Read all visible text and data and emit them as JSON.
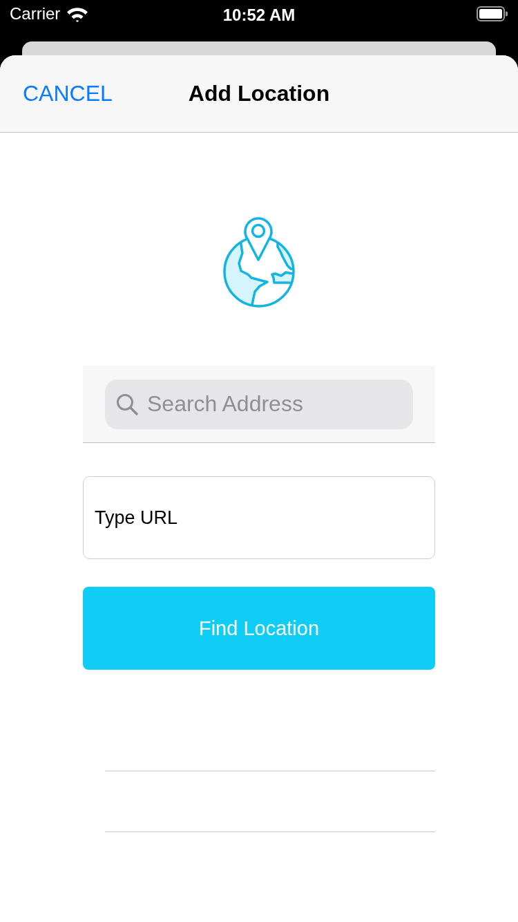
{
  "status_bar": {
    "carrier": "Carrier",
    "time": "10:52 AM"
  },
  "nav_bar": {
    "cancel": "CANCEL",
    "title": "Add Location"
  },
  "search": {
    "placeholder": "Search Address"
  },
  "url_field": {
    "value": "Type URL"
  },
  "find_button": {
    "label": "Find Location"
  }
}
